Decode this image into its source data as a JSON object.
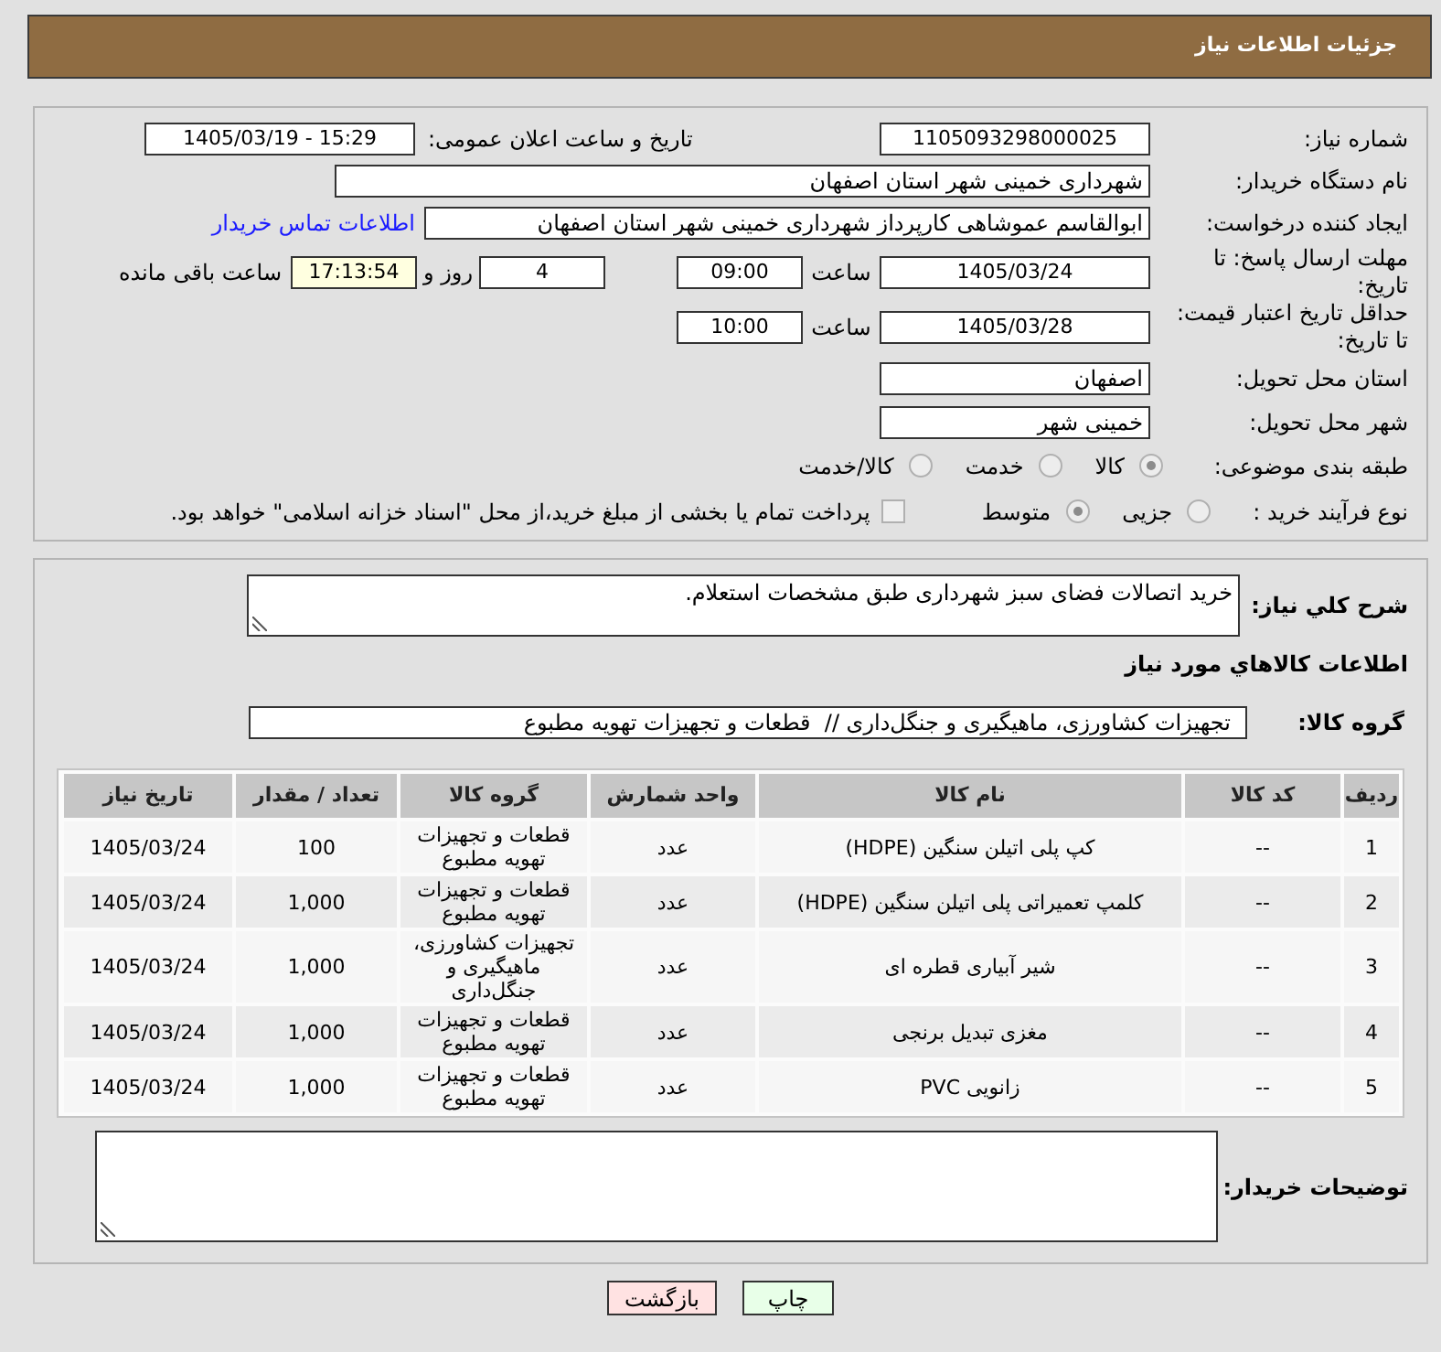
{
  "header": {
    "title": "جزئیات اطلاعات نیاز"
  },
  "need_info": {
    "need_number": {
      "label": "شماره نیاز:",
      "value": "1105093298000025"
    },
    "announce_datetime": {
      "label": "تاریخ و ساعت اعلان عمومی:",
      "value": "1405/03/19 - 15:29"
    },
    "buyer_org": {
      "label": "نام دستگاه خریدار:",
      "value": "شهرداری خمینی شهر استان اصفهان"
    },
    "requester": {
      "label": "ایجاد کننده درخواست:",
      "value": "ابوالقاسم عموشاهی کارپرداز شهرداری خمینی شهر استان اصفهان",
      "contact_link": "اطلاعات تماس خریدار"
    },
    "response_deadline": {
      "label": "مهلت ارسال پاسخ: تا تاریخ:",
      "date": "1405/03/24",
      "time_label": "ساعت",
      "time": "09:00",
      "days": "4",
      "days_label": "روز و",
      "time_left": "17:13:54",
      "time_left_label": "ساعت باقی مانده"
    },
    "price_validity": {
      "label": "حداقل تاریخ اعتبار قیمت: تا تاریخ:",
      "date": "1405/03/28",
      "time_label": "ساعت",
      "time": "10:00"
    },
    "delivery_province": {
      "label": "استان محل تحویل:",
      "value": "اصفهان"
    },
    "delivery_city": {
      "label": "شهر محل تحویل:",
      "value": "خمینی شهر"
    },
    "classification": {
      "label": "طبقه بندی موضوعی:",
      "options": [
        {
          "label": "کالا",
          "selected": true
        },
        {
          "label": "خدمت",
          "selected": false
        },
        {
          "label": "کالا/خدمت",
          "selected": false
        }
      ]
    },
    "purchase_process": {
      "label": "نوع فرآیند خرید :",
      "options": [
        {
          "label": "جزیی",
          "selected": false
        },
        {
          "label": "متوسط",
          "selected": true
        }
      ],
      "treasury_payment": {
        "label": "پرداخت تمام یا بخشی از مبلغ خرید،از محل \"اسناد خزانه اسلامی\" خواهد بود.",
        "checked": false
      }
    }
  },
  "items": {
    "description_label": "شرح کلي نياز:",
    "description": "خرید اتصالات فضای سبز شهرداری طبق مشخصات استعلام.",
    "heading": "اطلاعات کالاهاي مورد نياز",
    "group_label": "گروه کالا:",
    "group": "تجهیزات کشاورزی، ماهیگیری و جنگل‌داری //  قطعات و تجهیزات تهویه مطبوع",
    "table": {
      "columns": [
        "ردیف",
        "کد کالا",
        "نام کالا",
        "واحد شمارش",
        "گروه کالا",
        "تعداد / مقدار",
        "تاریخ نیاز"
      ],
      "rows": [
        [
          "1",
          "--",
          "کپ پلی اتیلن سنگین (HDPE)",
          "عدد",
          "قطعات و تجهیزات تهویه مطبوع",
          "100",
          "1405/03/24"
        ],
        [
          "2",
          "--",
          "کلمپ تعمیراتی پلی اتیلن سنگین (HDPE)",
          "عدد",
          "قطعات و تجهیزات تهویه مطبوع",
          "1,000",
          "1405/03/24"
        ],
        [
          "3",
          "--",
          "شیر آبیاری قطره ای",
          "عدد",
          "تجهیزات کشاورزی، ماهیگیری و جنگل‌داری",
          "1,000",
          "1405/03/24"
        ],
        [
          "4",
          "--",
          "مغزی تبدیل برنجی",
          "عدد",
          "قطعات و تجهیزات تهویه مطبوع",
          "1,000",
          "1405/03/24"
        ],
        [
          "5",
          "--",
          "زانویی PVC",
          "عدد",
          "قطعات و تجهیزات تهویه مطبوع",
          "1,000",
          "1405/03/24"
        ]
      ]
    },
    "buyer_notes_label": "توضیحات خریدار:"
  },
  "buttons": [
    {
      "label": "چاپ",
      "kind": "print"
    },
    {
      "label": "بازگشت",
      "kind": "back"
    }
  ]
}
